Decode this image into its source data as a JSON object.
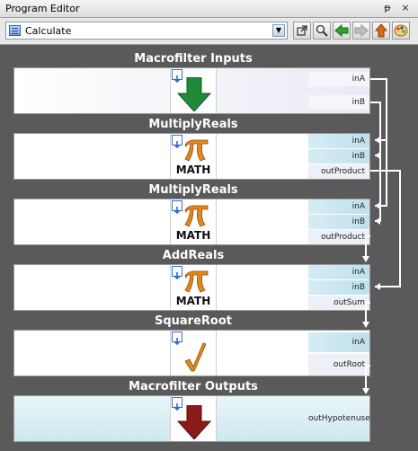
{
  "window": {
    "title": "Program Editor",
    "pin_glyph": "ᵽ",
    "close_glyph": "×"
  },
  "toolbar": {
    "program_select": "Calculate",
    "dropdown_glyph": "▼"
  },
  "blocks": [
    {
      "title": "Macrofilter Inputs",
      "ports": [
        "inA",
        "inB"
      ]
    },
    {
      "title": "MultiplyReals",
      "icon_text": "MATH",
      "ports_in": [
        "inA",
        "inB"
      ],
      "port_out": "outProduct"
    },
    {
      "title": "MultiplyReals",
      "icon_text": "MATH",
      "ports_in": [
        "inA",
        "inB"
      ],
      "port_out": "outProduct"
    },
    {
      "title": "AddReals",
      "icon_text": "MATH",
      "ports_in": [
        "inA",
        "inB"
      ],
      "port_out": "outSum"
    },
    {
      "title": "SquareRoot",
      "port_in": "inA",
      "port_out": "outRoot"
    },
    {
      "title": "Macrofilter Outputs",
      "ports": [
        "outHypotenuse"
      ]
    }
  ],
  "colors": {
    "canvas": "#5a5a5a",
    "wire": "#ffffff",
    "green_arrow": "#1f8a3a",
    "red_arrow": "#8b1a1a",
    "math_orange": "#e08a1e"
  }
}
